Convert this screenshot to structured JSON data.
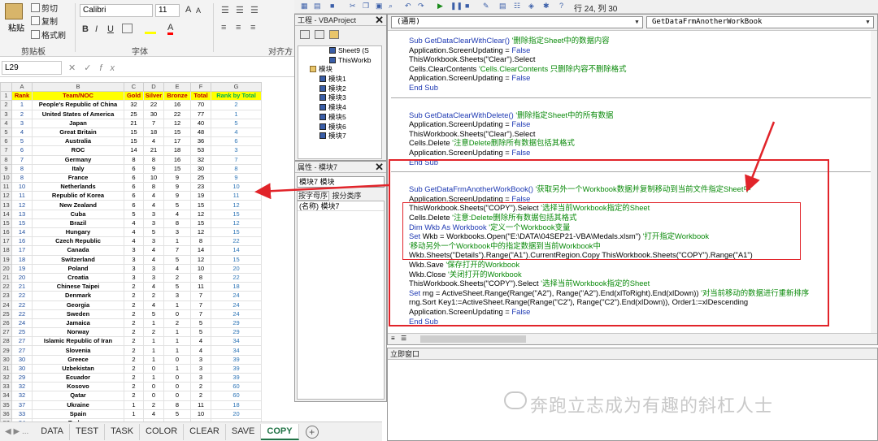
{
  "ribbon": {
    "cut": "剪切",
    "copy": "复制",
    "format_painter": "格式刷",
    "paste": "粘贴",
    "clipboard_group": "剪贴板",
    "font_name": "Calibri",
    "font_size": "11",
    "font_group": "字体",
    "align_group": "对齐方式",
    "bold": "B",
    "italic": "I",
    "underline": "U",
    "grow": "A",
    "shrink": "A"
  },
  "formula_bar": {
    "name_box": "L29",
    "cancel": "✕",
    "enter": "✓",
    "fx": "fx"
  },
  "columns": [
    "",
    "A",
    "B",
    "C",
    "D",
    "E",
    "F",
    "G"
  ],
  "header_row": [
    "1",
    "Rank",
    "Team/NOC",
    "Gold",
    "Silver",
    "Bronze",
    "Total",
    "Rank by Total"
  ],
  "rows": [
    [
      "2",
      "1",
      "People's Republic of China",
      "32",
      "22",
      "16",
      "70",
      "2"
    ],
    [
      "3",
      "2",
      "United States of America",
      "25",
      "30",
      "22",
      "77",
      "1"
    ],
    [
      "4",
      "3",
      "Japan",
      "21",
      "7",
      "12",
      "40",
      "5"
    ],
    [
      "5",
      "4",
      "Great Britain",
      "15",
      "18",
      "15",
      "48",
      "4"
    ],
    [
      "6",
      "5",
      "Australia",
      "15",
      "4",
      "17",
      "36",
      "6"
    ],
    [
      "7",
      "6",
      "ROC",
      "14",
      "21",
      "18",
      "53",
      "3"
    ],
    [
      "8",
      "7",
      "Germany",
      "8",
      "8",
      "16",
      "32",
      "7"
    ],
    [
      "9",
      "8",
      "Italy",
      "6",
      "9",
      "15",
      "30",
      "8"
    ],
    [
      "10",
      "8",
      "France",
      "6",
      "10",
      "9",
      "25",
      "9"
    ],
    [
      "11",
      "10",
      "Netherlands",
      "6",
      "8",
      "9",
      "23",
      "10"
    ],
    [
      "12",
      "11",
      "Republic of Korea",
      "6",
      "4",
      "9",
      "19",
      "11"
    ],
    [
      "13",
      "12",
      "New Zealand",
      "6",
      "4",
      "5",
      "15",
      "12"
    ],
    [
      "14",
      "13",
      "Cuba",
      "5",
      "3",
      "4",
      "12",
      "15"
    ],
    [
      "15",
      "15",
      "Brazil",
      "4",
      "3",
      "8",
      "15",
      "12"
    ],
    [
      "16",
      "14",
      "Hungary",
      "4",
      "5",
      "3",
      "12",
      "15"
    ],
    [
      "17",
      "16",
      "Czech Republic",
      "4",
      "3",
      "1",
      "8",
      "22"
    ],
    [
      "18",
      "17",
      "Canada",
      "3",
      "4",
      "7",
      "14",
      "14"
    ],
    [
      "19",
      "18",
      "Switzerland",
      "3",
      "4",
      "5",
      "12",
      "15"
    ],
    [
      "20",
      "19",
      "Poland",
      "3",
      "3",
      "4",
      "10",
      "20"
    ],
    [
      "21",
      "20",
      "Croatia",
      "3",
      "3",
      "2",
      "8",
      "22"
    ],
    [
      "22",
      "21",
      "Chinese Taipei",
      "2",
      "4",
      "5",
      "11",
      "18"
    ],
    [
      "23",
      "22",
      "Denmark",
      "2",
      "2",
      "3",
      "7",
      "24"
    ],
    [
      "24",
      "22",
      "Georgia",
      "2",
      "4",
      "1",
      "7",
      "24"
    ],
    [
      "25",
      "22",
      "Sweden",
      "2",
      "5",
      "0",
      "7",
      "24"
    ],
    [
      "26",
      "24",
      "Jamaica",
      "2",
      "1",
      "2",
      "5",
      "29"
    ],
    [
      "27",
      "25",
      "Norway",
      "2",
      "2",
      "1",
      "5",
      "29"
    ],
    [
      "28",
      "27",
      "Islamic Republic of Iran",
      "2",
      "1",
      "1",
      "4",
      "34"
    ],
    [
      "29",
      "27",
      "Slovenia",
      "2",
      "1",
      "1",
      "4",
      "34"
    ],
    [
      "30",
      "30",
      "Greece",
      "2",
      "1",
      "0",
      "3",
      "39"
    ],
    [
      "31",
      "30",
      "Uzbekistan",
      "2",
      "0",
      "1",
      "3",
      "39"
    ],
    [
      "32",
      "29",
      "Ecuador",
      "2",
      "1",
      "0",
      "3",
      "39"
    ],
    [
      "33",
      "32",
      "Kosovo",
      "2",
      "0",
      "0",
      "2",
      "60"
    ],
    [
      "34",
      "32",
      "Qatar",
      "2",
      "0",
      "0",
      "2",
      "60"
    ],
    [
      "35",
      "37",
      "Ukraine",
      "1",
      "2",
      "8",
      "11",
      "18"
    ],
    [
      "36",
      "33",
      "Spain",
      "1",
      "4",
      "5",
      "10",
      "20"
    ],
    [
      "37",
      "34",
      "Turkey",
      "",
      "",
      "",
      "",
      ""
    ]
  ],
  "sheet_tabs": [
    "DATA",
    "TEST",
    "TASK",
    "COLOR",
    "CLEAR",
    "SAVE",
    "COPY"
  ],
  "active_tab": "COPY",
  "vbe": {
    "cursor_pos": "行 24, 列 30",
    "project_title": "工程 - VBAProject",
    "tree": [
      {
        "label": "Sheet9 (S",
        "type": "sheet"
      },
      {
        "label": "ThisWorkb",
        "type": "sheet"
      },
      {
        "label": "模块",
        "type": "folder"
      },
      {
        "label": "模块1",
        "type": "module"
      },
      {
        "label": "模块2",
        "type": "module"
      },
      {
        "label": "模块3",
        "type": "module"
      },
      {
        "label": "模块4",
        "type": "module"
      },
      {
        "label": "模块5",
        "type": "module"
      },
      {
        "label": "模块6",
        "type": "module"
      },
      {
        "label": "模块7",
        "type": "module"
      }
    ],
    "props_title": "属性 - 模块7",
    "props_combo": "模块7 模块",
    "props_tab_alpha": "按字母序",
    "props_tab_cat": "按分类序",
    "props_row": "(名称) 模块7",
    "combo_general": "(通用)",
    "combo_proc": "GetDataFrmAnotherWorkBook",
    "immediate_title": "立即窗口"
  },
  "code_lines": [
    [
      {
        "t": "Sub GetDataClearWithClear() ",
        "c": "kw"
      },
      {
        "t": "'删除指定Sheet中的数据内容",
        "c": "cm"
      }
    ],
    [
      {
        "t": "Application.ScreenUpdating = ",
        "c": ""
      },
      {
        "t": "False",
        "c": "kw"
      }
    ],
    [
      {
        "t": "ThisWorkbook.Sheets(\"Clear\").Select",
        "c": ""
      }
    ],
    [
      {
        "t": "Cells.ClearContents ",
        "c": ""
      },
      {
        "t": "'Cells.ClearContents 只删除内容不删除格式",
        "c": "cm"
      }
    ],
    [
      {
        "t": "Application.ScreenUpdating = ",
        "c": ""
      },
      {
        "t": "False",
        "c": "kw"
      }
    ],
    [
      {
        "t": "End Sub",
        "c": "kw"
      }
    ],
    [
      {
        "t": "Sub GetDataClearWithDelete() ",
        "c": "kw"
      },
      {
        "t": "'删除指定Sheet中的所有数据",
        "c": "cm"
      }
    ],
    [
      {
        "t": "Application.ScreenUpdating = ",
        "c": ""
      },
      {
        "t": "False",
        "c": "kw"
      }
    ],
    [
      {
        "t": "ThisWorkbook.Sheets(\"Clear\").Select",
        "c": ""
      }
    ],
    [
      {
        "t": "Cells.Delete ",
        "c": ""
      },
      {
        "t": "'注意Delete删除所有数据包括其格式",
        "c": "cm"
      }
    ],
    [
      {
        "t": "Application.ScreenUpdating = ",
        "c": ""
      },
      {
        "t": "False",
        "c": "kw"
      }
    ],
    [
      {
        "t": "End Sub",
        "c": "kw"
      }
    ],
    [
      {
        "t": "Sub GetDataFrmAnotherWorkBook() ",
        "c": "kw"
      },
      {
        "t": "'获取另外一个Workbook数据并复制移动到当前文件指定Sheet中",
        "c": "cm"
      }
    ],
    [
      {
        "t": "Application.ScreenUpdating = ",
        "c": ""
      },
      {
        "t": "False",
        "c": "kw"
      }
    ],
    [
      {
        "t": "ThisWorkbook.Sheets(\"COPY\").Select ",
        "c": ""
      },
      {
        "t": "'选择当前Workbook指定的Sheet",
        "c": "cm"
      }
    ],
    [
      {
        "t": "Cells.Delete ",
        "c": ""
      },
      {
        "t": "'注意:Delete删除所有数据包括其格式",
        "c": "cm"
      }
    ],
    [
      {
        "t": "Dim Wkb As Workbook ",
        "c": "kw"
      },
      {
        "t": "'定义一个Workbook变量",
        "c": "cm"
      }
    ],
    [
      {
        "t": "Set ",
        "c": "kw"
      },
      {
        "t": "Wkb = Workbooks.Open(\"E:\\DATA\\04SEP21-VBA\\Medals.xlsm\") ",
        "c": ""
      },
      {
        "t": "'打开指定Workbook",
        "c": "cm"
      }
    ],
    [
      {
        "t": "'移动另外一个Workbook中的指定数据到当前Workbook中",
        "c": "cm"
      }
    ],
    [
      {
        "t": "Wkb.Sheets(\"Details\").Range(\"A1\").CurrentRegion.Copy ThisWorkbook.Sheets(\"COPY\").Range(\"A1\")",
        "c": ""
      }
    ],
    [
      {
        "t": "Wkb.Save ",
        "c": ""
      },
      {
        "t": "'保存打开的Workbook",
        "c": "cm"
      }
    ],
    [
      {
        "t": "Wkb.Close ",
        "c": ""
      },
      {
        "t": "'关闭打开的Workbook",
        "c": "cm"
      }
    ],
    [
      {
        "t": "ThisWorkbook.Sheets(\"COPY\").Select ",
        "c": ""
      },
      {
        "t": "'选择当前Workbook指定的Sheet",
        "c": "cm"
      }
    ],
    [
      {
        "t": "Set ",
        "c": "kw"
      },
      {
        "t": "rng = ActiveSheet.Range(Range(\"A2\"), Range(\"A2\").End(xlToRight).End(xlDown)) ",
        "c": ""
      },
      {
        "t": "'对当前移动的数据进行重新排序",
        "c": "cm"
      }
    ],
    [
      {
        "t": "rng.Sort Key1:=ActiveSheet.Range(Range(\"C2\"), Range(\"C2\").End(xlDown)), Order1:=xlDescending",
        "c": ""
      }
    ],
    [
      {
        "t": "Application.ScreenUpdating = ",
        "c": ""
      },
      {
        "t": "False",
        "c": "kw"
      }
    ],
    [
      {
        "t": "End Sub",
        "c": "kw"
      }
    ]
  ],
  "watermark": "奔跑立志成为有趣的斜杠人士",
  "colors": {
    "annotation_red": "#e1242a",
    "header_yellow": "#ffff00",
    "header_text": "#c00000",
    "keyword_blue": "#1f3ab3",
    "comment_green": "#0a8a0a",
    "active_tab_green": "#217346"
  }
}
